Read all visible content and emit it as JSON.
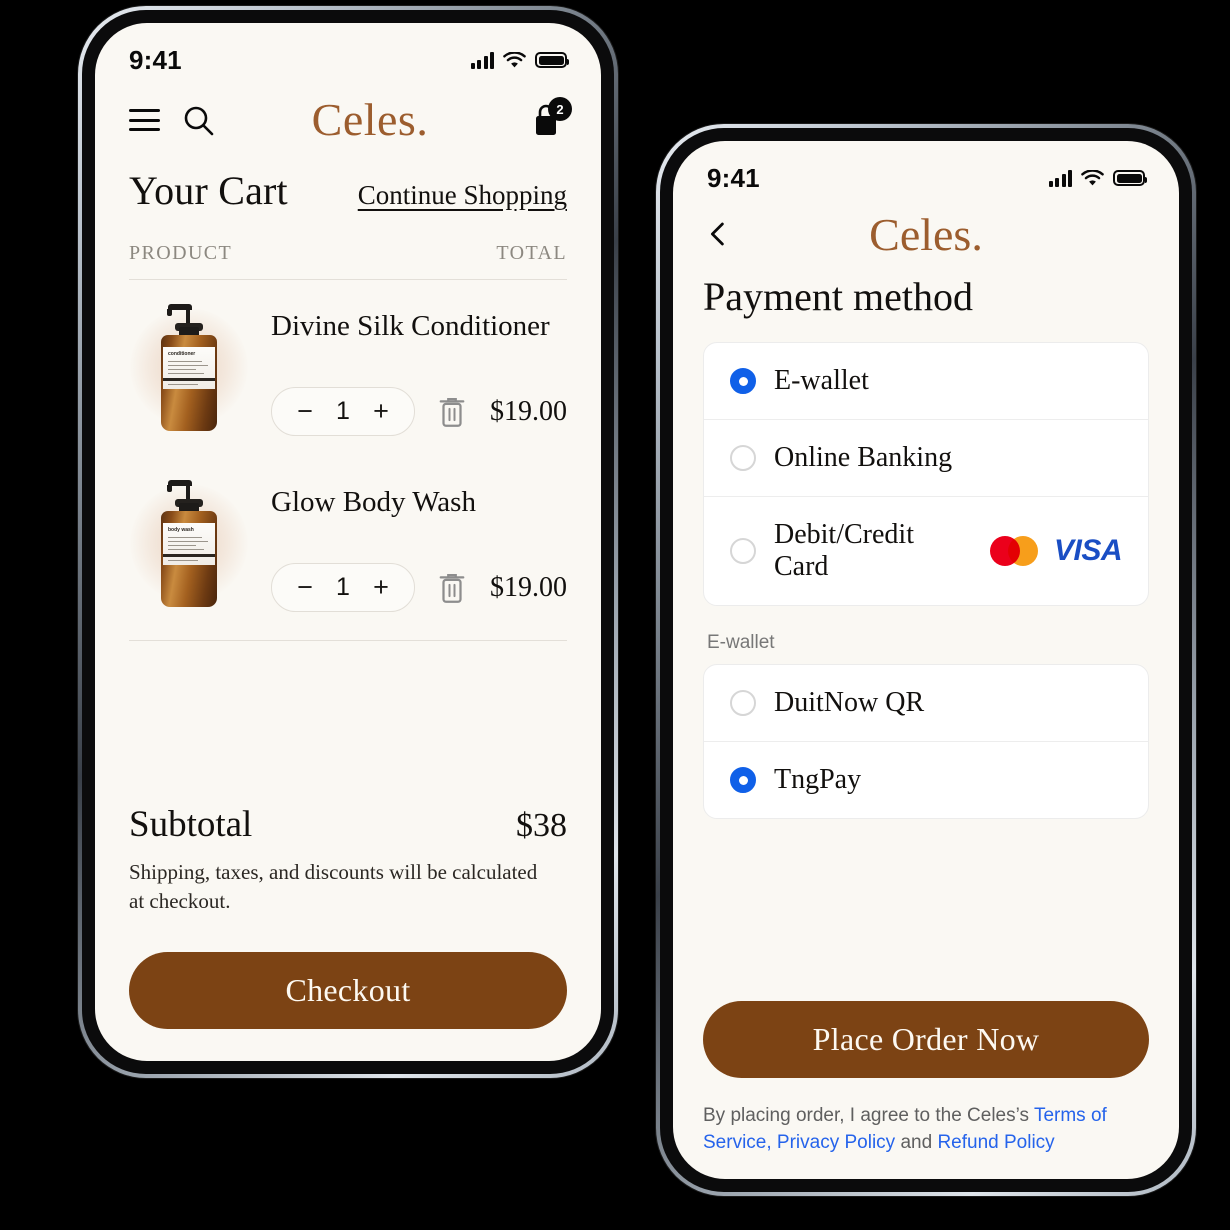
{
  "cart_screen": {
    "status_bar": {
      "time": "9:41",
      "signal_icon": "signal-bars-icon",
      "wifi_icon": "wifi-icon",
      "battery_icon": "battery-icon"
    },
    "appbar": {
      "menu_icon": "hamburger-menu-icon",
      "search_icon": "search-icon",
      "brand": "Celes.",
      "bag_icon": "shopping-bag-icon",
      "bag_count": "2"
    },
    "title": "Your Cart",
    "continue_shopping": "Continue Shopping",
    "columns": {
      "product": "PRODUCT",
      "total": "TOTAL"
    },
    "items": [
      {
        "name": "Divine Silk Conditioner",
        "label_text": "conditioner",
        "quantity": "1",
        "price": "$19.00",
        "minus": "−",
        "plus": "+",
        "delete_icon": "trash-icon"
      },
      {
        "name": "Glow Body Wash",
        "label_text": "body wash",
        "quantity": "1",
        "price": "$19.00",
        "minus": "−",
        "plus": "+",
        "delete_icon": "trash-icon"
      }
    ],
    "subtotal_label": "Subtotal",
    "subtotal_value": "$38",
    "subtotal_note": "Shipping, taxes, and discounts will be calculated at checkout.",
    "checkout_button": "Checkout"
  },
  "payment_screen": {
    "status_bar": {
      "time": "9:41",
      "signal_icon": "signal-bars-icon",
      "wifi_icon": "wifi-icon",
      "battery_icon": "battery-icon"
    },
    "appbar": {
      "back_icon": "chevron-left-icon",
      "brand": "Celes."
    },
    "title": "Payment method",
    "methods": [
      {
        "label": "E-wallet",
        "selected": true
      },
      {
        "label": "Online Banking",
        "selected": false
      },
      {
        "label": "Debit/Credit Card",
        "selected": false,
        "logos": [
          "mastercard-logo",
          "visa-logo"
        ],
        "visa_text": "VISA"
      }
    ],
    "ewallet_section_label": "E-wallet",
    "ewallets": [
      {
        "label": "DuitNow QR",
        "selected": false
      },
      {
        "label": "TngPay",
        "selected": true
      }
    ],
    "place_order_button": "Place Order Now",
    "terms": {
      "prefix": "By placing order, I agree to the Celes’s ",
      "link1": "Terms of Service,",
      "link2": "Privacy Policy",
      "middle": " and ",
      "link3": "Refund Policy"
    }
  },
  "colors": {
    "page_background": "#000000",
    "screen_background": "#faf8f3",
    "brand_brown": "#9c5d2e",
    "cta_brown": "#7c4314",
    "radio_blue": "#1060e8",
    "link_blue": "#2563eb",
    "card_white": "#ffffff",
    "mastercard_red": "#eb001b",
    "mastercard_orange": "#f79e1b",
    "visa_blue": "#1a4ec4"
  }
}
